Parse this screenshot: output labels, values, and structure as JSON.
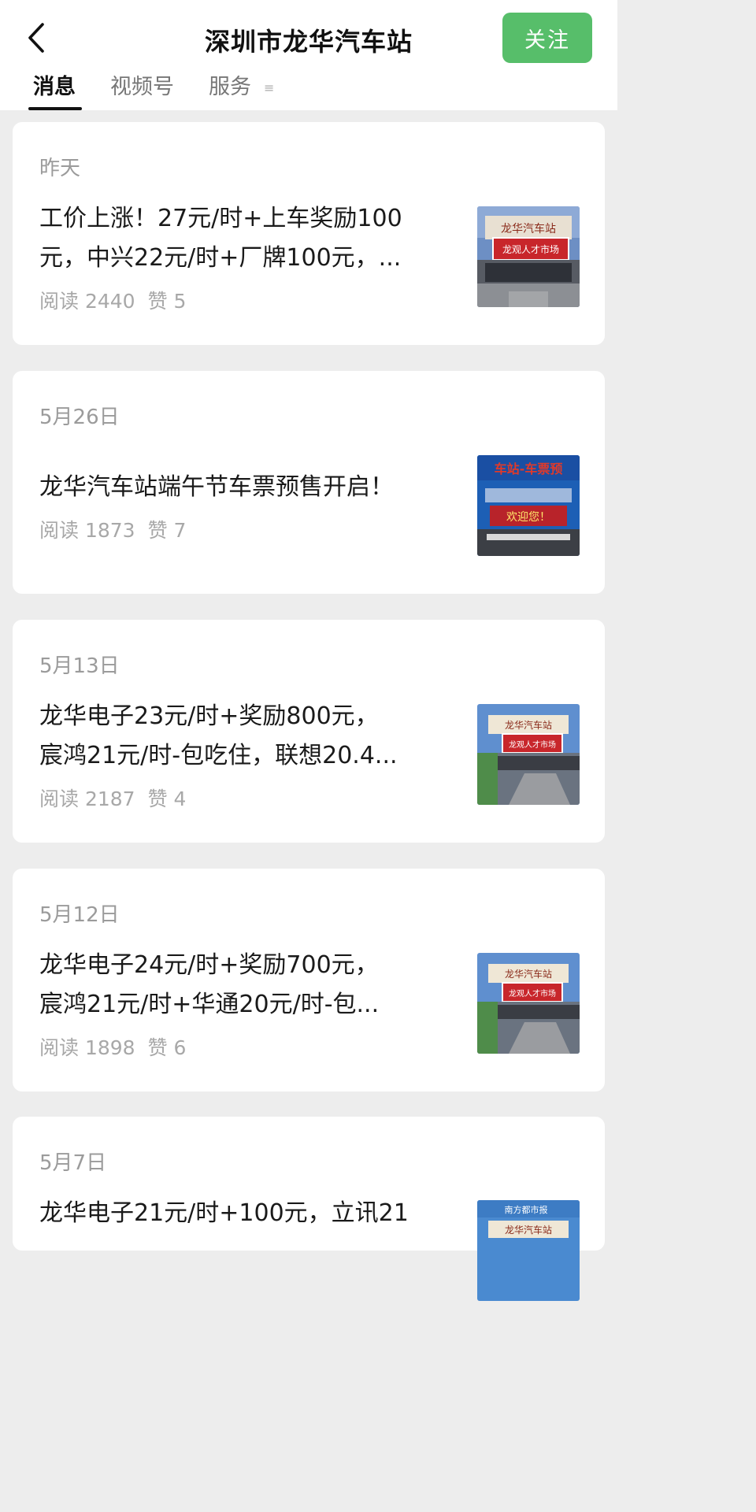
{
  "header": {
    "title": "深圳市龙华汽车站",
    "follow_label": "关注",
    "back_icon": "chevron-left-icon"
  },
  "tabs": [
    {
      "label": "消息",
      "active": true
    },
    {
      "label": "视频号",
      "active": false
    },
    {
      "label": "服务",
      "active": false
    }
  ],
  "tab_menu_glyph": "≡",
  "articles": [
    {
      "date": "昨天",
      "title_line1": "工价上涨！27元/时+上车奖励100",
      "title_line2": "元，中兴22元/时+厂牌100元，...",
      "read_label": "阅读 2440",
      "like_label": "赞 5",
      "thumb_sign": "龙华汽车站",
      "thumb_banner": "龙观人才市场"
    },
    {
      "date": "5月26日",
      "title_line1": "龙华汽车站端午节车票预售开启！",
      "title_line2": "",
      "read_label": "阅读 1873",
      "like_label": "赞 7",
      "thumb_sign": "车站-车票预",
      "thumb_banner": "欢迎您！"
    },
    {
      "date": "5月13日",
      "title_line1": "龙华电子23元/时+奖励800元，",
      "title_line2": "宸鸿21元/时-包吃住，联想20.4...",
      "read_label": "阅读 2187",
      "like_label": "赞 4",
      "thumb_sign": "龙华汽车站",
      "thumb_banner": "龙观人才市场"
    },
    {
      "date": "5月12日",
      "title_line1": "龙华电子24元/时+奖励700元，",
      "title_line2": "宸鸿21元/时+华通20元/时-包...",
      "read_label": "阅读 1898",
      "like_label": "赞 6",
      "thumb_sign": "龙华汽车站",
      "thumb_banner": "龙观人才市场"
    },
    {
      "date": "5月7日",
      "title_line1": "龙华电子21元/时+100元，立讯21",
      "title_line2": "",
      "read_label": "",
      "like_label": "",
      "thumb_sign": "南方都市报",
      "thumb_banner": "龙华汽车站"
    }
  ],
  "colors": {
    "accent_green": "#57be6a",
    "page_bg": "#ededed",
    "card_bg": "#ffffff",
    "muted_text": "#9b9b9b"
  }
}
